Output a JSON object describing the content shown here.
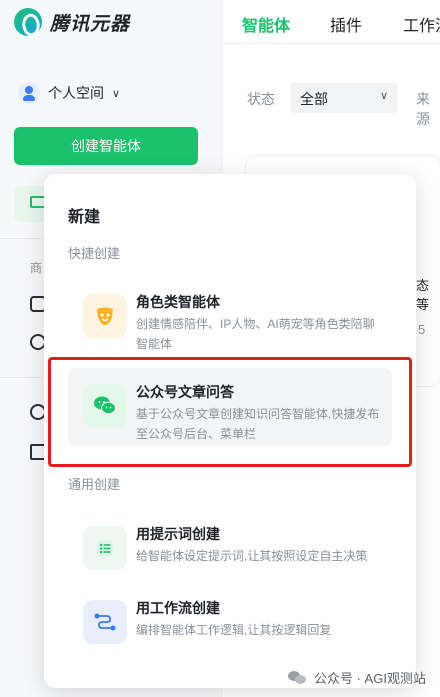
{
  "brand": {
    "name": "腾讯元器"
  },
  "sidebar": {
    "space_label": "个人空间",
    "create_button": "创建智能体",
    "section_label_partial": "商"
  },
  "header": {
    "tabs": [
      {
        "label": "智能体",
        "active": true
      },
      {
        "label": "插件",
        "active": false
      },
      {
        "label": "工作流",
        "active": false
      }
    ]
  },
  "filters": {
    "status_label": "状态",
    "status_value": "全部",
    "source_label": "来源"
  },
  "background_fragments": {
    "text1": "态等",
    "text2": "5"
  },
  "popup": {
    "title": "新建",
    "quick_section": "快捷创建",
    "general_section": "通用创建",
    "items": [
      {
        "title": "角色类智能体",
        "desc": "创建情感陪伴、IP人物、AI萌宠等角色类陪聊智能体",
        "icon": "mask-icon",
        "icon_bg": "#fff4e0",
        "icon_color": "#ffb020"
      },
      {
        "title": "公众号文章问答",
        "desc": "基于公众号文章创建知识问答智能体,快捷发布至公众号后台、菜单栏",
        "icon": "wechat-icon",
        "icon_bg": "#e3f7ea",
        "icon_color": "#19c26b",
        "highlighted": true
      },
      {
        "title": "用提示词创建",
        "desc": "给智能体设定提示词,让其按照设定自主决策",
        "icon": "list-icon",
        "icon_bg": "#eef7f1",
        "icon_color": "#19c26b"
      },
      {
        "title": "用工作流创建",
        "desc": "编排智能体工作逻辑,让其按逻辑回复",
        "icon": "workflow-icon",
        "icon_bg": "#e8eefc",
        "icon_color": "#3a7afe"
      }
    ]
  },
  "watermark": {
    "text": "公众号 · AGI观测站"
  },
  "colors": {
    "accent": "#19c26b",
    "highlight_border": "#e0201c"
  }
}
